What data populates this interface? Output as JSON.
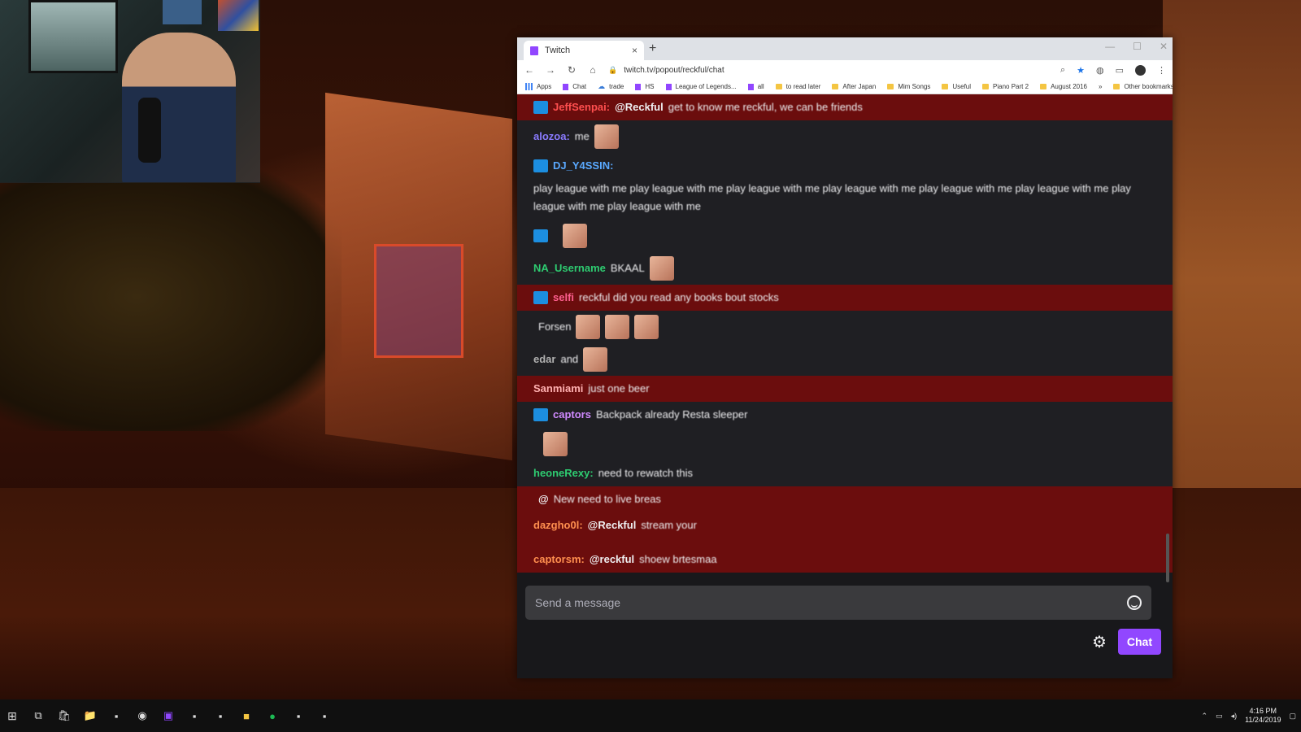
{
  "browser": {
    "tab_title": "Twitch",
    "tab_close": "×",
    "new_tab": "+",
    "window_controls": [
      "—",
      "☐",
      "✕"
    ],
    "url": "twitch.tv/popout/reckful/chat",
    "nav": {
      "back": "←",
      "forward": "→",
      "reload": "↻",
      "home": "⌂"
    }
  },
  "bookmarks": [
    {
      "label": "Apps",
      "icon": "apps-icon"
    },
    {
      "label": "Chat",
      "icon": "twitch-icon"
    },
    {
      "label": "trade",
      "icon": "cloud-icon"
    },
    {
      "label": "HS",
      "icon": "twitch-icon"
    },
    {
      "label": "League of Legends...",
      "icon": "twitch-icon"
    },
    {
      "label": "all",
      "icon": "twitch-icon"
    },
    {
      "label": "to read later",
      "icon": "folder-icon"
    },
    {
      "label": "After Japan",
      "icon": "folder-icon"
    },
    {
      "label": "Mim Songs",
      "icon": "folder-icon"
    },
    {
      "label": "Useful",
      "icon": "folder-icon"
    },
    {
      "label": "Piano Part 2",
      "icon": "folder-icon"
    },
    {
      "label": "August 2016",
      "icon": "folder-icon"
    }
  ],
  "bookmarks_more": "»",
  "bookmarks_other": "Other bookmarks",
  "chat": {
    "messages": [
      {
        "style": "red",
        "badge": true,
        "name": "JeffSenpai:",
        "name_color": "#ff4f4f",
        "mention": "@Reckful",
        "text": "get to know me reckful, we can be friends",
        "emotes": 0
      },
      {
        "style": "dark",
        "badge": false,
        "name": "alozoa:",
        "name_color": "#8a7bff",
        "mention": "",
        "text": "me",
        "emotes": 1
      },
      {
        "style": "dark",
        "badge": true,
        "name": "DJ_Y4SSIN:",
        "name_color": "#5aa9ff",
        "mention": "",
        "text": "play league with me  play league with me  play league with me  play league with me  play league with me  play league with me  play league with me  play league with me",
        "emotes": 0
      },
      {
        "style": "dark",
        "badge": true,
        "name": "",
        "name_color": "#2ecc40",
        "mention": "",
        "text": "",
        "emotes": 1
      },
      {
        "style": "dark",
        "badge": false,
        "name": "NA_Username",
        "name_color": "#2ecc71",
        "mention": "",
        "text": "BKAAL",
        "emotes": 1
      },
      {
        "style": "red",
        "badge": true,
        "name": "selfi",
        "name_color": "#ff5f8f",
        "mention": "",
        "text": "reckful did you read any books bout stocks",
        "emotes": 0
      },
      {
        "style": "dark",
        "badge": false,
        "name": "",
        "name_color": "#2ecc71",
        "mention": "",
        "text": "Forsen",
        "emotes": 3
      },
      {
        "style": "dark",
        "badge": false,
        "name": "edar",
        "name_color": "#b0b0b0",
        "mention": "",
        "text": "and",
        "emotes": 1
      },
      {
        "style": "red",
        "badge": false,
        "name": "Sanmiami",
        "name_color": "#ffb0b0",
        "mention": "",
        "text": "just one beer",
        "emotes": 0
      },
      {
        "style": "dark",
        "badge": true,
        "name": "captors",
        "name_color": "#d08aff",
        "mention": "",
        "text": "Backpack already Resta  sleeper",
        "emotes": 0
      },
      {
        "style": "dark",
        "badge": false,
        "name": "",
        "name_color": "#888",
        "mention": "",
        "text": "",
        "emotes": 1
      },
      {
        "style": "dark",
        "badge": false,
        "name": "heoneRexy:",
        "name_color": "#2ecc71",
        "mention": "",
        "text": "need to rewatch this",
        "emotes": 0
      },
      {
        "style": "red",
        "badge": false,
        "name": "",
        "name_color": "#888",
        "mention": "@",
        "text": "New need to live breas",
        "emotes": 0
      },
      {
        "style": "red",
        "badge": false,
        "name": "dazgho0l:",
        "name_color": "#ff8f4f",
        "mention": "@Reckful",
        "text": "stream your",
        "emotes": 0
      },
      {
        "style": "red",
        "badge": false,
        "name": "",
        "name_color": "#ff4f4f",
        "mention": "",
        "text": "",
        "emotes": 0
      },
      {
        "style": "red",
        "badge": false,
        "name": "captorsm:",
        "name_color": "#ff8f4f",
        "mention": "@reckful",
        "text": "shoew brtesmaa",
        "emotes": 0
      }
    ],
    "input_placeholder": "Send a message",
    "chat_button": "Chat",
    "settings_icon": "⚙"
  },
  "taskbar": {
    "time": "4:16 PM",
    "date": "11/24/2019",
    "apps": [
      "start-icon",
      "task-view-icon",
      "store-icon",
      "file-explorer-icon",
      "app-icon",
      "chrome-icon",
      "twitch-icon",
      "app-icon",
      "app-icon",
      "sticky-notes-icon",
      "spotify-icon",
      "app-icon",
      "app-icon"
    ]
  },
  "colors": {
    "twitch_purple": "#9147ff",
    "chat_bg": "#18181b",
    "highlight_red": "#6b0d0d"
  }
}
